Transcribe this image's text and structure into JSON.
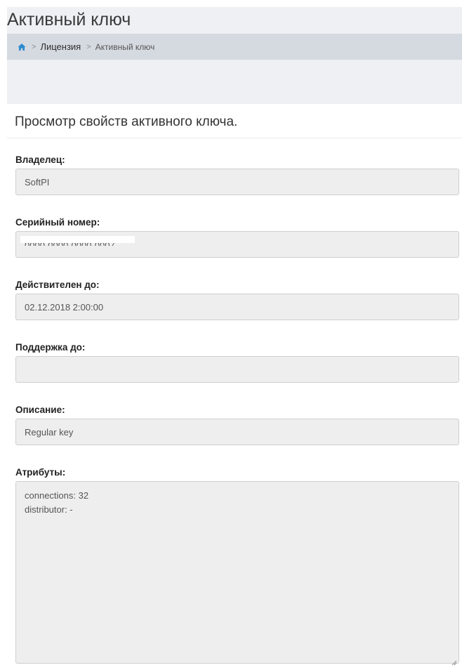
{
  "header": {
    "title": "Активный ключ"
  },
  "breadcrumb": {
    "home_icon": "home-icon",
    "separator": ">",
    "items": [
      "Лицензия",
      "Активный ключ"
    ]
  },
  "panel": {
    "heading": "Просмотр свойств активного ключа."
  },
  "fields": {
    "owner": {
      "label": "Владелец:",
      "value": "SoftPI"
    },
    "serial": {
      "label": "Серийный номер:",
      "value": "0000-0000-0000-0007"
    },
    "valid_until": {
      "label": "Действителен до:",
      "value": "02.12.2018 2:00:00"
    },
    "support_until": {
      "label": "Поддержка до:",
      "value": ""
    },
    "description": {
      "label": "Описание:",
      "value": "Regular key"
    },
    "attributes": {
      "label": "Атрибуты:",
      "lines": [
        "connections: 32",
        "distributor: -"
      ]
    }
  },
  "colors": {
    "accent": "#2b8ccf",
    "field_bg": "#eeeeee",
    "breadcrumb_bg": "#d5d9e0"
  }
}
